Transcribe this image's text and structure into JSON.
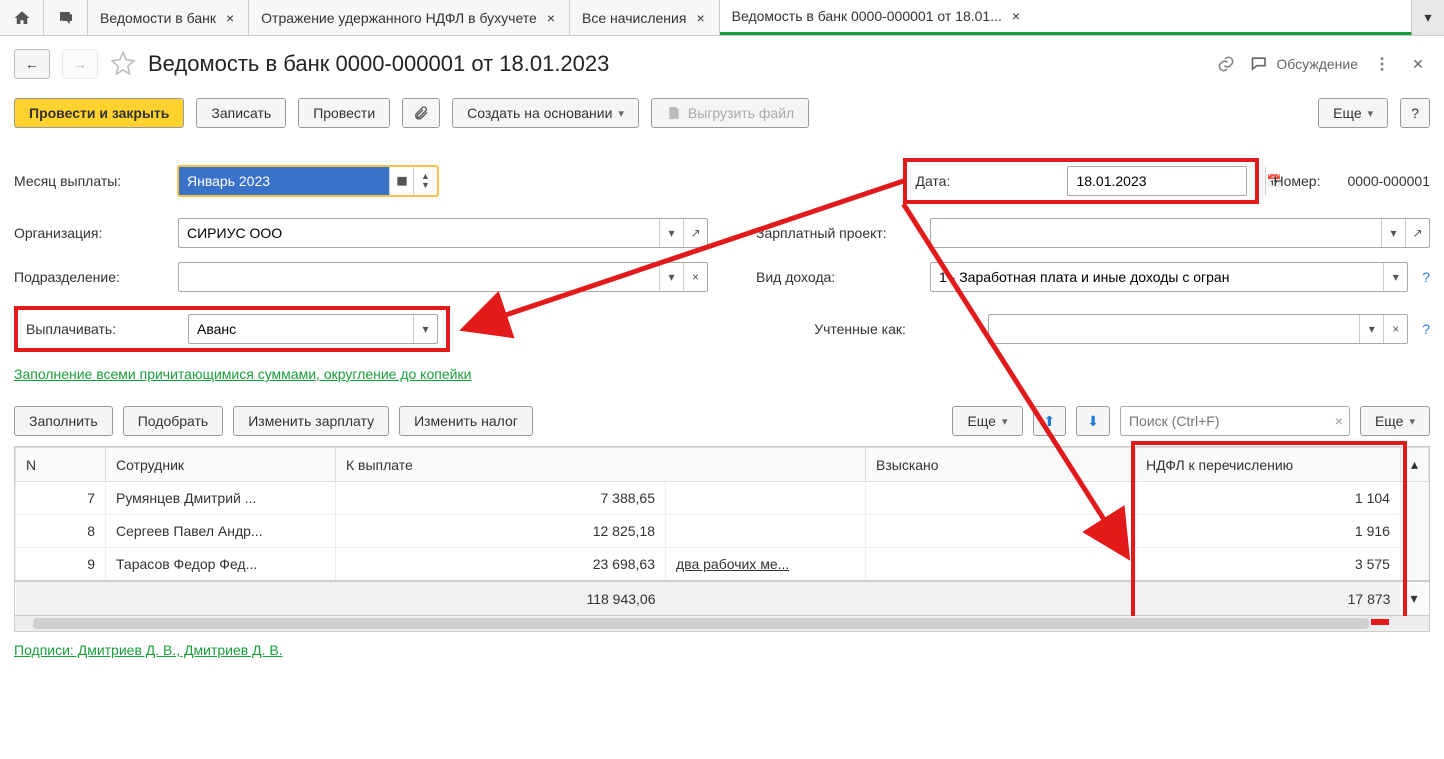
{
  "tabs": {
    "items": [
      {
        "label": "Ведомости в банк"
      },
      {
        "label": "Отражение удержанного НДФЛ в бухучете"
      },
      {
        "label": "Все начисления"
      },
      {
        "label": "Ведомость в банк 0000-000001 от 18.01..."
      }
    ]
  },
  "header": {
    "title": "Ведомость в банк 0000-000001 от 18.01.2023",
    "discuss": "Обсуждение"
  },
  "toolbar": {
    "postAndClose": "Провести и закрыть",
    "write": "Записать",
    "post": "Провести",
    "createBased": "Создать на основании",
    "export": "Выгрузить файл",
    "more": "Еще"
  },
  "form": {
    "monthLabel": "Месяц выплаты:",
    "month": "Январь 2023",
    "dateLabel": "Дата:",
    "date": "18.01.2023",
    "numberLabel": "Номер:",
    "number": "0000-000001",
    "orgLabel": "Организация:",
    "org": "СИРИУС ООО",
    "salaryProjectLabel": "Зарплатный проект:",
    "divisionLabel": "Подразделение:",
    "incomeTypeLabel": "Вид дохода:",
    "incomeType": "1 - Заработная плата и иные доходы с огран",
    "payLabel": "Выплачивать:",
    "pay": "Аванс",
    "recordedAsLabel": "Учтенные как:",
    "fillNote": "Заполнение всеми причитающимися суммами, округление до копейки"
  },
  "tableToolbar": {
    "fill": "Заполнить",
    "pick": "Подобрать",
    "editSalary": "Изменить зарплату",
    "editTax": "Изменить налог",
    "more": "Еще",
    "searchPlaceholder": "Поиск (Ctrl+F)"
  },
  "table": {
    "cols": {
      "n": "N",
      "employee": "Сотрудник",
      "toPay": "К выплате",
      "penalized": "Взыскано",
      "ndfl": "НДФЛ к перечислению"
    },
    "rows": [
      {
        "n": "7",
        "employee": "Румянцев Дмитрий ...",
        "toPay": "7 388,65",
        "note": "",
        "ndfl": "1 104"
      },
      {
        "n": "8",
        "employee": "Сергеев Павел Андр...",
        "toPay": "12 825,18",
        "note": "",
        "ndfl": "1 916"
      },
      {
        "n": "9",
        "employee": "Тарасов Федор Фед...",
        "toPay": "23 698,63",
        "note": "два рабочих ме...",
        "ndfl": "3 575"
      }
    ],
    "totals": {
      "toPay": "118 943,06",
      "ndfl": "17 873"
    }
  },
  "footer": {
    "signatures": "Подписи: Дмитриев Д. В., Дмитриев Д. В."
  },
  "highlights": {
    "color": "#e21a1a"
  }
}
